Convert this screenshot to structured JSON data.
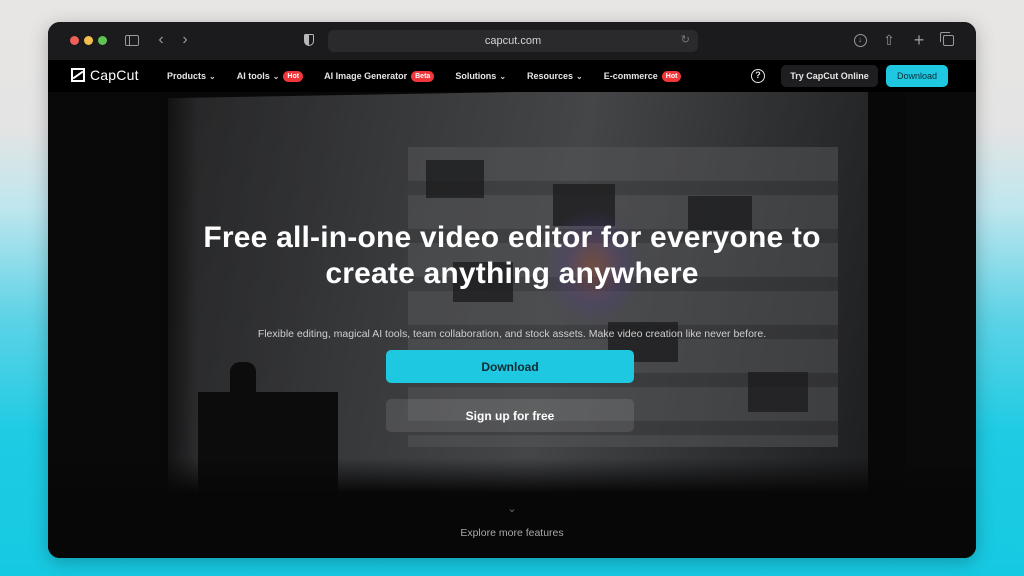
{
  "browser": {
    "url": "capcut.com",
    "icons": [
      "sidebar-icon",
      "back-icon",
      "forward-icon",
      "shield-icon",
      "reload-icon",
      "download-icon",
      "share-icon",
      "new-tab-icon",
      "tabs-overview-icon"
    ]
  },
  "nav": {
    "logo": "CapCut",
    "items": [
      {
        "label": "Products",
        "chevron": true,
        "badge": null
      },
      {
        "label": "AI tools",
        "chevron": true,
        "badge": "Hot"
      },
      {
        "label": "AI Image Generator",
        "chevron": false,
        "badge": "Beta"
      },
      {
        "label": "Solutions",
        "chevron": true,
        "badge": null
      },
      {
        "label": "Resources",
        "chevron": true,
        "badge": null
      },
      {
        "label": "E-commerce",
        "chevron": false,
        "badge": "Hot"
      }
    ],
    "help_icon": "?",
    "try_online": "Try CapCut Online",
    "download": "Download"
  },
  "hero": {
    "title_line1": "Free all-in-one video editor for everyone to",
    "title_line2": "create anything anywhere",
    "subtitle": "Flexible editing, magical AI tools, team collaboration, and stock assets. Make video creation like never before.",
    "primary_button": "Download",
    "secondary_button": "Sign up for free",
    "explore": "Explore more features"
  },
  "colors": {
    "accent": "#1ec8e0",
    "badge": "#f0363b",
    "background": "#0c0c0d"
  }
}
